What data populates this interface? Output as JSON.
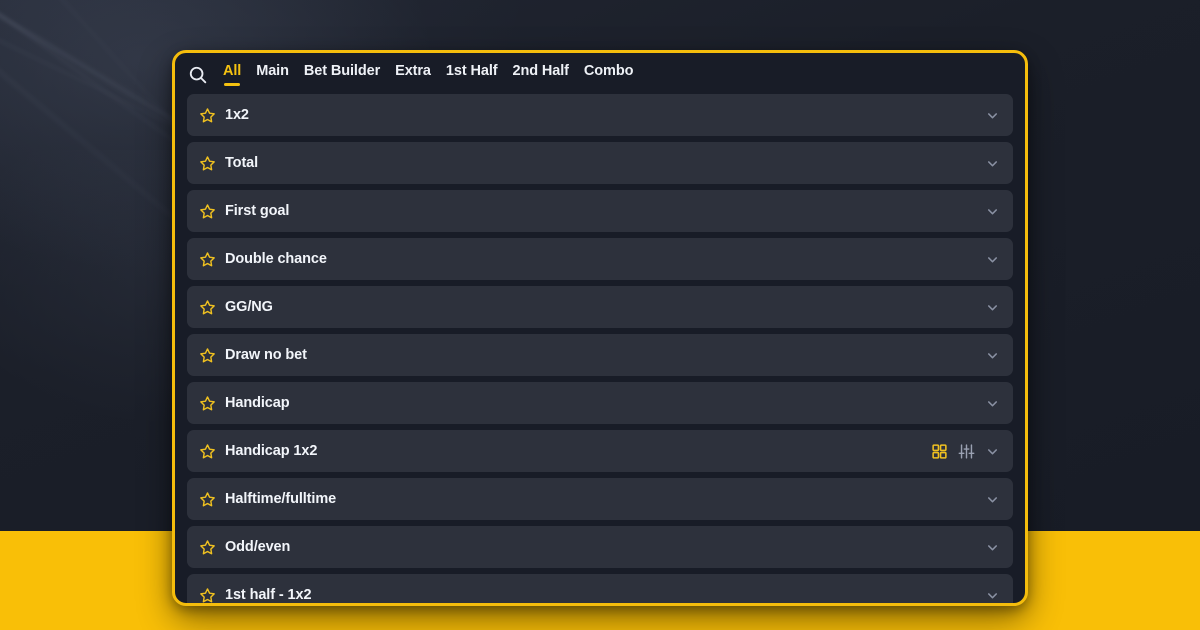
{
  "background": {
    "dark_color": "#1b1f29",
    "accent_band_color": "#f9bf07"
  },
  "card": {
    "border_color": "#f5bd0c",
    "surface_color": "#181c27",
    "row_color": "#2d313c"
  },
  "search": {
    "icon": "search-icon"
  },
  "tabs": [
    {
      "label": "All",
      "active": true
    },
    {
      "label": "Main",
      "active": false
    },
    {
      "label": "Bet Builder",
      "active": false
    },
    {
      "label": "Extra",
      "active": false
    },
    {
      "label": "1st Half",
      "active": false
    },
    {
      "label": "2nd Half",
      "active": false
    },
    {
      "label": "Combo",
      "active": false
    }
  ],
  "markets": [
    {
      "label": "1x2",
      "star": "star-icon",
      "chevron": "chevron-down-icon",
      "extra_icons": []
    },
    {
      "label": "Total",
      "star": "star-icon",
      "chevron": "chevron-down-icon",
      "extra_icons": []
    },
    {
      "label": "First goal",
      "star": "star-icon",
      "chevron": "chevron-down-icon",
      "extra_icons": []
    },
    {
      "label": "Double chance",
      "star": "star-icon",
      "chevron": "chevron-down-icon",
      "extra_icons": []
    },
    {
      "label": "GG/NG",
      "star": "star-icon",
      "chevron": "chevron-down-icon",
      "extra_icons": []
    },
    {
      "label": "Draw no bet",
      "star": "star-icon",
      "chevron": "chevron-down-icon",
      "extra_icons": []
    },
    {
      "label": "Handicap",
      "star": "star-icon",
      "chevron": "chevron-down-icon",
      "extra_icons": []
    },
    {
      "label": "Handicap 1x2",
      "star": "star-icon",
      "chevron": "chevron-down-icon",
      "extra_icons": [
        "grid-view-icon",
        "sliders-icon"
      ]
    },
    {
      "label": "Halftime/fulltime",
      "star": "star-icon",
      "chevron": "chevron-down-icon",
      "extra_icons": []
    },
    {
      "label": "Odd/even",
      "star": "star-icon",
      "chevron": "chevron-down-icon",
      "extra_icons": []
    },
    {
      "label": "1st half - 1x2",
      "star": "star-icon",
      "chevron": "chevron-down-icon",
      "extra_icons": []
    }
  ]
}
